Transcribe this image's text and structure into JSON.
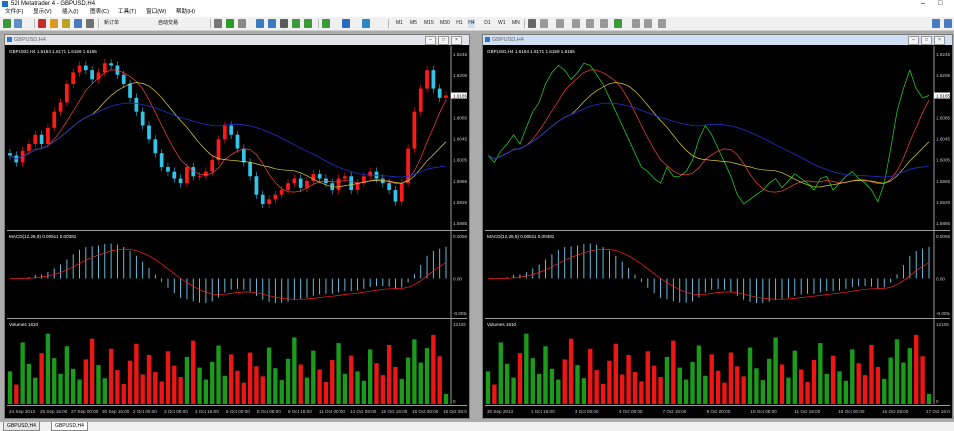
{
  "app": {
    "title": "52I Metatrader 4 - GBPUSD,H4",
    "min": "–",
    "restore": "□"
  },
  "menu": [
    "文件(F)",
    "显示(V)",
    "插入(I)",
    "图表(C)",
    "工具(T)",
    "窗口(W)",
    "帮助(H)"
  ],
  "toolbar": {
    "new_order": "新订单",
    "auto_trade": "自动交易",
    "timeframes": [
      "M1",
      "M5",
      "M15",
      "M30",
      "H1",
      "H4",
      "D1",
      "W1",
      "MN"
    ]
  },
  "windows": [
    {
      "title": "GBPUSD,H4",
      "info": "GBPUSD,H4  1.6164 1.6171 1.6159 1.6165",
      "kind": "candles",
      "macd_label": "MACD(12,26,9) 0.00511 0.00381",
      "volume_label": "Volumes 1610",
      "dates": [
        "24 Sep 2013",
        "25 Sep 16:00",
        "27 Sep 00:00",
        "30 Sep 16:00",
        "2 Oct 00:00",
        "3 Oct 08:00",
        "4 Oct 16:00",
        "6 Oct 00:00",
        "8 Oct 08:00",
        "9 Oct 16:00",
        "11 Oct 00:00",
        "14 Oct 08:00",
        "15 Oct 16:00",
        "16 Oct 00:00",
        "18 Oct 08:00"
      ]
    },
    {
      "title": "GBPUSD,H4",
      "info": "GBPUSD,H4  1.6164 1.6171 1.6159 1.6165",
      "kind": "line",
      "macd_label": "MACD(12,26,9) 0.00511 0.00381",
      "volume_label": "Volumes 1610",
      "dates": [
        "30 Sep 2013",
        "1 Oct 16:00",
        "3 Oct 00:00",
        "4 Oct 08:00",
        "7 Oct 16:00",
        "9 Oct 00:00",
        "10 Oct 08:00",
        "11 Oct 16:00",
        "15 Oct 00:00",
        "16 Oct 08:00",
        "17 Oct 16:00"
      ]
    }
  ],
  "price_axis": [
    "1.6245",
    "1.6205",
    "1.6125",
    "1.6085",
    "1.6045",
    "1.6005",
    "1.5965",
    "1.5925",
    "1.5885"
  ],
  "current_price": "1.6165",
  "macd_axis": [
    "0.00563",
    "0.00",
    "-0.00543"
  ],
  "volume_axis": [
    "12106",
    "0"
  ],
  "tabs": [
    "GBPUSD,H4",
    "GBPUSD,H4"
  ],
  "colors": {
    "bull": "#ff1a1a",
    "bear": "#33c4e8",
    "close_line": "#22dd22",
    "ma_fast": "#ff4040",
    "ma_mid": "#e0d040",
    "ma_slow": "#2030d0",
    "macd_hist": "#6fd0f0",
    "signal": "#ff2020",
    "vol_up": "#1b9a1b",
    "vol_down": "#ee1515"
  },
  "chart_data": {
    "type": "line",
    "symbol": "GBPUSD",
    "timeframe": "H4",
    "close": [
      1.6035,
      1.602,
      1.6045,
      1.606,
      1.608,
      1.606,
      1.6095,
      1.613,
      1.615,
      1.619,
      1.6215,
      1.623,
      1.622,
      1.62,
      1.6215,
      1.6235,
      1.623,
      1.621,
      1.619,
      1.616,
      1.613,
      1.61,
      1.607,
      1.604,
      1.601,
      1.6,
      1.5985,
      1.5975,
      1.601,
      1.599,
      1.599,
      1.6,
      1.6025,
      1.607,
      1.61,
      1.608,
      1.605,
      1.602,
      1.599,
      1.595,
      1.593,
      1.594,
      1.595,
      1.596,
      1.5975,
      1.5985,
      1.5965,
      1.598,
      1.5995,
      1.5985,
      1.5975,
      1.596,
      1.5985,
      1.599,
      1.596,
      1.5975,
      1.599,
      1.6,
      1.5985,
      1.5975,
      1.596,
      1.5935,
      1.5975,
      1.605,
      1.613,
      1.618,
      1.622,
      1.618,
      1.616,
      1.6165
    ],
    "volume": [
      5200,
      3100,
      9800,
      6400,
      4200,
      8100,
      11200,
      7300,
      4800,
      9200,
      5600,
      3900,
      7100,
      10400,
      6200,
      4100,
      8800,
      5400,
      3200,
      6900,
      9600,
      4700,
      7800,
      5100,
      3600,
      8400,
      6100,
      4300,
      7500,
      10100,
      5800,
      3900,
      6700,
      9300,
      4500,
      7900,
      5300,
      3400,
      8200,
      6000,
      4400,
      9000,
      5700,
      3800,
      7200,
      10600,
      6300,
      4200,
      8500,
      5500,
      3500,
      7000,
      9700,
      4800,
      7700,
      5200,
      3700,
      8700,
      6500,
      4600,
      9400,
      5900,
      4000,
      7400,
      10300,
      6600,
      8900,
      11000,
      7600,
      1610
    ]
  }
}
